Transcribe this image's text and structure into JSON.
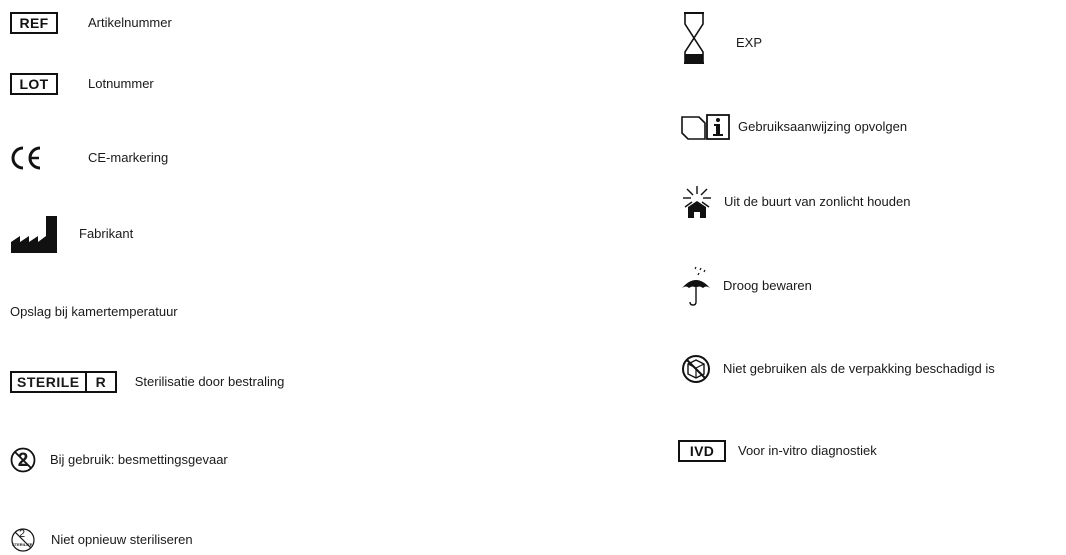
{
  "left_column": [
    {
      "symbol": "REF",
      "label": "Artikelnummer"
    },
    {
      "symbol": "LOT",
      "label": "Lotnummer"
    },
    {
      "symbol": "ce-mark-icon",
      "label": "CE-markering"
    },
    {
      "symbol": "manufacturer-icon",
      "label": "Fabrikant"
    },
    {
      "symbol": "",
      "label": "Opslag bij kamertemperatuur"
    },
    {
      "symbol": "STERILE R",
      "sterile_text": "STERILE",
      "sterile_r": "R",
      "label": "Sterilisatie door bestraling"
    },
    {
      "symbol": "do-not-reuse-icon",
      "glyph": "2",
      "label": "Bij gebruik: besmettingsgevaar"
    },
    {
      "symbol": "do-not-resterilize-icon",
      "glyph": "2",
      "glyph_text": "STERILIZE",
      "label": "Niet opnieuw steriliseren"
    }
  ],
  "right_column": [
    {
      "symbol": "hourglass-icon",
      "label": "EXP"
    },
    {
      "symbol": "instructions-icon",
      "label": "Gebruiksaanwijzing opvolgen"
    },
    {
      "symbol": "keep-away-sunlight-icon",
      "label": "Uit de buurt van zonlicht houden"
    },
    {
      "symbol": "keep-dry-icon",
      "label": "Droog bewaren"
    },
    {
      "symbol": "damaged-package-icon",
      "label": "Niet gebruiken als de verpakking beschadigd is"
    },
    {
      "symbol": "IVD",
      "label": "Voor in-vitro diagnostiek"
    }
  ]
}
